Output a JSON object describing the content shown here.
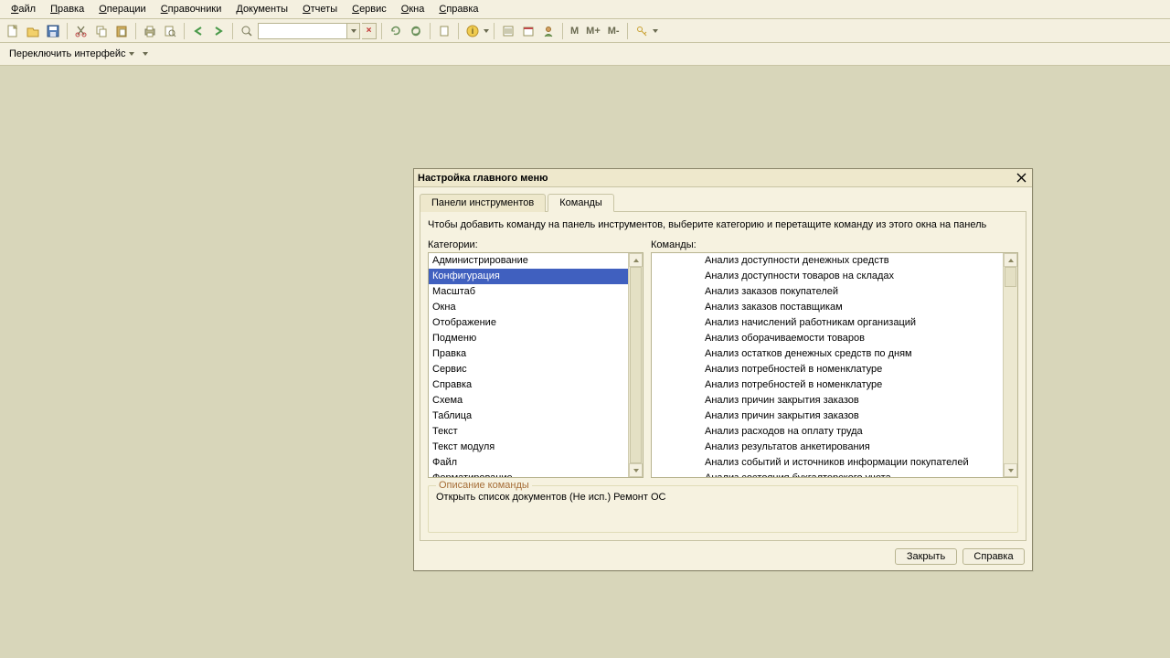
{
  "menu": [
    "Файл",
    "Правка",
    "Операции",
    "Справочники",
    "Документы",
    "Отчеты",
    "Сервис",
    "Окна",
    "Справка"
  ],
  "toolbar2": {
    "switch_label": "Переключить интерфейс"
  },
  "mbuttons": [
    "M",
    "M+",
    "M-"
  ],
  "dialog": {
    "title": "Настройка главного меню",
    "tabs": [
      "Панели инструментов",
      "Команды"
    ],
    "active_tab": 1,
    "hint": "Чтобы добавить команду на панель инструментов, выберите категорию и перетащите команду из этого окна на панель",
    "categories_label": "Категории:",
    "commands_label": "Команды:",
    "categories": [
      "Администрирование",
      "Конфигурация",
      "Масштаб",
      "Окна",
      "Отображение",
      "Подменю",
      "Правка",
      "Сервис",
      "Справка",
      "Схема",
      "Таблица",
      "Текст",
      "Текст модуля",
      "Файл",
      "Форматирование"
    ],
    "selected_category_index": 1,
    "commands": [
      "Анализ доступности денежных средств",
      "Анализ доступности товаров на складах",
      "Анализ заказов покупателей",
      "Анализ заказов поставщикам",
      "Анализ начислений работникам организаций",
      "Анализ оборачиваемости товаров",
      "Анализ остатков денежных средств по дням",
      "Анализ потребностей в номенклатуре",
      "Анализ потребностей в номенклатуре",
      "Анализ причин закрытия заказов",
      "Анализ причин закрытия заказов",
      "Анализ расходов на оплату труда",
      "Анализ результатов анкетирования",
      "Анализ событий и источников информации покупателей",
      "Анализ состояния бухгалтерского учета"
    ],
    "desc_legend": "Описание команды",
    "desc_text": "Открыть список документов (Не исп.) Ремонт ОС",
    "close_btn": "Закрыть",
    "help_btn": "Справка"
  }
}
